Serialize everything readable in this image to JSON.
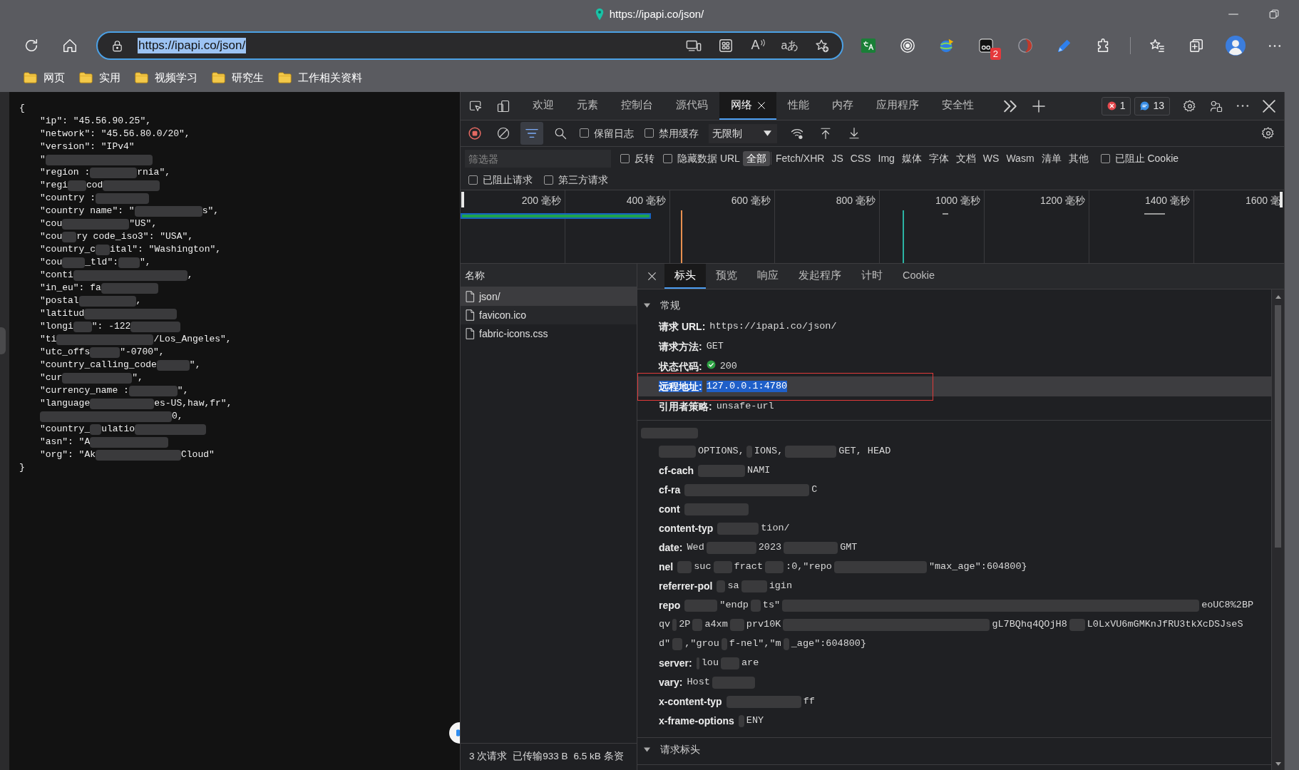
{
  "browser": {
    "title": "https://ipapi.co/json/",
    "address": {
      "url": "https://ipapi.co/json/",
      "text_selected": true
    },
    "read_aloud_label": "A",
    "translate_label": "aあ",
    "extension_badge": "2",
    "bookmarks": [
      "网页",
      "实用",
      "视频学习",
      "研究生",
      "工作相关资料"
    ]
  },
  "page": {
    "open": "{",
    "entries": [
      {
        "segments": [
          {
            "kind": "text",
            "text": "\"ip\": \"45.56.90.25\","
          }
        ]
      },
      {
        "segments": [
          {
            "kind": "text",
            "text": "\"network\": \"45.56.80.0/20\","
          }
        ]
      },
      {
        "segments": [
          {
            "kind": "text",
            "text": "\"version\": \"IPv4\""
          }
        ]
      },
      {
        "segments": [
          {
            "kind": "text",
            "text": "\""
          },
          {
            "kind": "scribble"
          }
        ]
      },
      {
        "segments": [
          {
            "kind": "text",
            "text": "\"region :"
          },
          {
            "kind": "scribble"
          },
          {
            "kind": "text",
            "text": "rnia\","
          }
        ]
      },
      {
        "segments": [
          {
            "kind": "text",
            "text": "\"regi"
          },
          {
            "kind": "scribble"
          },
          {
            "kind": "text",
            "text": "cod"
          },
          {
            "kind": "scribble"
          }
        ]
      },
      {
        "segments": [
          {
            "kind": "text",
            "text": "\"country :"
          },
          {
            "kind": "scribble"
          }
        ]
      },
      {
        "segments": [
          {
            "kind": "text",
            "text": "\"country name\": \""
          },
          {
            "kind": "scribble"
          },
          {
            "kind": "text",
            "text": "s\","
          }
        ]
      },
      {
        "segments": [
          {
            "kind": "text",
            "text": "\"cou"
          },
          {
            "kind": "scribble"
          },
          {
            "kind": "text",
            "text": "\"US\","
          }
        ]
      },
      {
        "segments": [
          {
            "kind": "text",
            "text": "\"cou"
          },
          {
            "kind": "scribble"
          },
          {
            "kind": "text",
            "text": "ry code_iso3\": \"USA\","
          }
        ]
      },
      {
        "segments": [
          {
            "kind": "text",
            "text": "\"country_c"
          },
          {
            "kind": "scribble"
          },
          {
            "kind": "text",
            "text": "ital\": \"Washington\","
          }
        ]
      },
      {
        "segments": [
          {
            "kind": "text",
            "text": "\"cou"
          },
          {
            "kind": "scribble"
          },
          {
            "kind": "text",
            "text": "_tld\":"
          },
          {
            "kind": "scribble"
          },
          {
            "kind": "text",
            "text": "\","
          }
        ]
      },
      {
        "segments": [
          {
            "kind": "text",
            "text": "\"conti"
          },
          {
            "kind": "scribble"
          },
          {
            "kind": "text",
            "text": ","
          }
        ]
      },
      {
        "segments": [
          {
            "kind": "text",
            "text": "\"in_eu\": fa"
          },
          {
            "kind": "scribble"
          }
        ]
      },
      {
        "segments": [
          {
            "kind": "text",
            "text": "\"postal"
          },
          {
            "kind": "scribble"
          },
          {
            "kind": "text",
            "text": ","
          }
        ]
      },
      {
        "segments": [
          {
            "kind": "text",
            "text": "\"latitud"
          },
          {
            "kind": "scribble"
          }
        ]
      },
      {
        "segments": [
          {
            "kind": "text",
            "text": "\"longi"
          },
          {
            "kind": "scribble"
          },
          {
            "kind": "text",
            "text": "\": -122"
          },
          {
            "kind": "scribble"
          }
        ]
      },
      {
        "segments": [
          {
            "kind": "text",
            "text": "\"ti"
          },
          {
            "kind": "scribble"
          },
          {
            "kind": "text",
            "text": "/Los_Angeles\","
          }
        ]
      },
      {
        "segments": [
          {
            "kind": "text",
            "text": "\"utc_offs"
          },
          {
            "kind": "scribble"
          },
          {
            "kind": "text",
            "text": "\"-0700\","
          }
        ]
      },
      {
        "segments": [
          {
            "kind": "text",
            "text": "\"country_calling_code"
          },
          {
            "kind": "scribble"
          },
          {
            "kind": "text",
            "text": "\","
          }
        ]
      },
      {
        "segments": [
          {
            "kind": "text",
            "text": "\"cur"
          },
          {
            "kind": "scribble"
          },
          {
            "kind": "text",
            "text": "\","
          }
        ]
      },
      {
        "segments": [
          {
            "kind": "text",
            "text": "\"currency_name :"
          },
          {
            "kind": "scribble"
          },
          {
            "kind": "text",
            "text": "\","
          }
        ]
      },
      {
        "segments": [
          {
            "kind": "text",
            "text": "\"language"
          },
          {
            "kind": "scribble"
          },
          {
            "kind": "text",
            "text": "es-US,haw,fr\","
          }
        ]
      },
      {
        "segments": [
          {
            "kind": "scribble"
          },
          {
            "kind": "text",
            "text": "0,"
          }
        ]
      },
      {
        "segments": [
          {
            "kind": "text",
            "text": "\"country_"
          },
          {
            "kind": "scribble"
          },
          {
            "kind": "text",
            "text": "ulatio"
          },
          {
            "kind": "scribble"
          }
        ]
      },
      {
        "segments": [
          {
            "kind": "text",
            "text": "\"asn\": \"A"
          },
          {
            "kind": "scribble"
          }
        ]
      },
      {
        "segments": [
          {
            "kind": "text",
            "text": "\"org\": \"Ak"
          },
          {
            "kind": "scribble"
          },
          {
            "kind": "text",
            "text": "Cloud\""
          }
        ]
      }
    ],
    "close": "}"
  },
  "devtools": {
    "tabs": [
      {
        "label": "欢迎",
        "selected": false
      },
      {
        "label": "元素",
        "selected": false
      },
      {
        "label": "控制台",
        "selected": false
      },
      {
        "label": "源代码",
        "selected": false
      },
      {
        "label": "网络",
        "selected": true
      },
      {
        "label": "性能",
        "selected": false
      },
      {
        "label": "内存",
        "selected": false
      },
      {
        "label": "应用程序",
        "selected": false
      },
      {
        "label": "安全性",
        "selected": false
      }
    ],
    "error_count": "1",
    "message_count": "13",
    "toolbar": {
      "recording": true,
      "filter_active": true,
      "checkboxes": [
        {
          "label": "保留日志",
          "checked": false
        },
        {
          "label": "禁用缓存",
          "checked": false
        }
      ],
      "throttling": "无限制"
    },
    "filter": {
      "placeholder": "筛选器",
      "options": [
        {
          "label": "反转",
          "checked": false
        },
        {
          "label": "隐藏数据 URL",
          "checked": false
        }
      ],
      "types": [
        {
          "label": "全部",
          "selected": true
        },
        {
          "label": "Fetch/XHR",
          "selected": false
        },
        {
          "label": "JS",
          "selected": false
        },
        {
          "label": "CSS",
          "selected": false
        },
        {
          "label": "Img",
          "selected": false
        },
        {
          "label": "媒体",
          "selected": false
        },
        {
          "label": "字体",
          "selected": false
        },
        {
          "label": "文档",
          "selected": false
        },
        {
          "label": "WS",
          "selected": false
        },
        {
          "label": "Wasm",
          "selected": false
        },
        {
          "label": "清单",
          "selected": false
        },
        {
          "label": "其他",
          "selected": false
        }
      ],
      "more_options": [
        {
          "label": "已阻止 Cookie",
          "checked": false
        }
      ],
      "second_row": [
        {
          "label": "已阻止请求",
          "checked": false
        },
        {
          "label": "第三方请求",
          "checked": false
        }
      ]
    },
    "timeline": {
      "ticks": [
        "200 毫秒",
        "400 毫秒",
        "600 毫秒",
        "800 毫秒",
        "1000 毫秒",
        "1200 毫秒",
        "1400 毫秒",
        "1600 毫"
      ]
    },
    "requests": {
      "header": "名称",
      "items": [
        {
          "name": "json/",
          "selected": true
        },
        {
          "name": "favicon.ico",
          "selected": false
        },
        {
          "name": "fabric-icons.css",
          "selected": false
        }
      ]
    },
    "status_bar": [
      "3 次请求",
      "已传输933 B",
      "6.5 kB 条资"
    ],
    "details": {
      "tabs": [
        {
          "label": "标头",
          "selected": true
        },
        {
          "label": "预览",
          "selected": false
        },
        {
          "label": "响应",
          "selected": false
        },
        {
          "label": "发起程序",
          "selected": false
        },
        {
          "label": "计时",
          "selected": false
        },
        {
          "label": "Cookie",
          "selected": false
        }
      ],
      "sections": [
        {
          "kind": "general",
          "title": "常规",
          "expanded": true,
          "rows": [
            {
              "kind": "plain",
              "name": "请求 URL:",
              "value": "https://ipapi.co/json/",
              "selected": false,
              "annotated": false
            },
            {
              "kind": "plain",
              "name": "请求方法:",
              "value": "GET",
              "selected": false,
              "annotated": false
            },
            {
              "kind": "status",
              "name": "状态代码:",
              "value": "200",
              "selected": false,
              "annotated": false
            },
            {
              "kind": "plain",
              "name": "远程地址:",
              "value": "127.0.0.1:4780",
              "selected": true,
              "annotated": true
            },
            {
              "kind": "plain",
              "name": "引用者策略:",
              "value": "unsafe-url",
              "selected": false,
              "annotated": false
            }
          ]
        },
        {
          "kind": "redacted",
          "rows": [
            {
              "segments": [
                {
                  "kind": "scribble"
                },
                {
                  "kind": "value",
                  "text": "OPTIONS,"
                },
                {
                  "kind": "scribble"
                },
                {
                  "kind": "value",
                  "text": "IONS,"
                },
                {
                  "kind": "scribble"
                },
                {
                  "kind": "value",
                  "text": "GET, HEAD"
                }
              ]
            },
            {
              "segments": [
                {
                  "kind": "name",
                  "text": "cf-cach"
                },
                {
                  "kind": "scribble"
                },
                {
                  "kind": "value",
                  "text": "NAMI"
                }
              ]
            },
            {
              "segments": [
                {
                  "kind": "name",
                  "text": "cf-ra"
                },
                {
                  "kind": "scribble"
                },
                {
                  "kind": "value",
                  "text": "C"
                }
              ]
            },
            {
              "segments": [
                {
                  "kind": "name",
                  "text": "cont"
                },
                {
                  "kind": "scribble"
                }
              ]
            },
            {
              "segments": [
                {
                  "kind": "name",
                  "text": "content-typ"
                },
                {
                  "kind": "scribble"
                },
                {
                  "kind": "value",
                  "text": "tion/"
                }
              ]
            },
            {
              "segments": [
                {
                  "kind": "name",
                  "text": "date:"
                },
                {
                  "kind": "value",
                  "text": "Wed"
                },
                {
                  "kind": "scribble"
                },
                {
                  "kind": "value",
                  "text": "2023"
                },
                {
                  "kind": "scribble"
                },
                {
                  "kind": "value",
                  "text": "GMT"
                }
              ]
            },
            {
              "segments": [
                {
                  "kind": "name",
                  "text": "nel"
                },
                {
                  "kind": "scribble"
                },
                {
                  "kind": "value",
                  "text": "suc"
                },
                {
                  "kind": "scribble"
                },
                {
                  "kind": "value",
                  "text": "fract"
                },
                {
                  "kind": "scribble"
                },
                {
                  "kind": "value",
                  "text": ":0,\"repo"
                },
                {
                  "kind": "scribble"
                },
                {
                  "kind": "value",
                  "text": "\"max_age\":604800}"
                }
              ]
            },
            {
              "segments": [
                {
                  "kind": "name",
                  "text": "referrer-pol"
                },
                {
                  "kind": "scribble"
                },
                {
                  "kind": "value",
                  "text": "sa"
                },
                {
                  "kind": "scribble"
                },
                {
                  "kind": "value",
                  "text": "igin"
                }
              ]
            },
            {
              "segments": [
                {
                  "kind": "name",
                  "text": "repo"
                },
                {
                  "kind": "scribble"
                },
                {
                  "kind": "value",
                  "text": "\"endp"
                },
                {
                  "kind": "scribble"
                },
                {
                  "kind": "value",
                  "text": "ts\""
                },
                {
                  "kind": "scribble"
                },
                {
                  "kind": "value",
                  "text": "eoUC8%2BP"
                }
              ]
            },
            {
              "segments": [
                {
                  "kind": "value",
                  "text": "qv"
                },
                {
                  "kind": "scribble"
                },
                {
                  "kind": "value",
                  "text": "2P"
                },
                {
                  "kind": "scribble"
                },
                {
                  "kind": "value",
                  "text": "a4xm"
                },
                {
                  "kind": "scribble"
                },
                {
                  "kind": "value",
                  "text": "prv10K"
                },
                {
                  "kind": "scribble"
                },
                {
                  "kind": "value",
                  "text": "gL7BQhq4QOjH8"
                },
                {
                  "kind": "scribble"
                },
                {
                  "kind": "value",
                  "text": "L0LxVU6mGMKnJfRU3tkXcDSJseS"
                }
              ]
            },
            {
              "segments": [
                {
                  "kind": "value",
                  "text": "d\""
                },
                {
                  "kind": "scribble"
                },
                {
                  "kind": "value",
                  "text": ",\"grou"
                },
                {
                  "kind": "scribble"
                },
                {
                  "kind": "value",
                  "text": "f-nel\",\"m"
                },
                {
                  "kind": "scribble"
                },
                {
                  "kind": "value",
                  "text": "_age\":604800}"
                }
              ]
            },
            {
              "segments": [
                {
                  "kind": "name",
                  "text": "server:"
                },
                {
                  "kind": "scribble"
                },
                {
                  "kind": "value",
                  "text": "lou"
                },
                {
                  "kind": "scribble"
                },
                {
                  "kind": "value",
                  "text": "are"
                }
              ]
            },
            {
              "segments": [
                {
                  "kind": "name",
                  "text": "vary:"
                },
                {
                  "kind": "value",
                  "text": "Host"
                },
                {
                  "kind": "scribble"
                }
              ]
            },
            {
              "segments": [
                {
                  "kind": "name",
                  "text": "x-content-typ"
                },
                {
                  "kind": "scribble"
                },
                {
                  "kind": "value",
                  "text": "ff"
                }
              ]
            },
            {
              "segments": [
                {
                  "kind": "name",
                  "text": "x-frame-options"
                },
                {
                  "kind": "scribble"
                },
                {
                  "kind": "value",
                  "text": "ENY"
                }
              ]
            }
          ]
        },
        {
          "kind": "general",
          "title": "请求标头",
          "expanded": true
        }
      ]
    }
  }
}
